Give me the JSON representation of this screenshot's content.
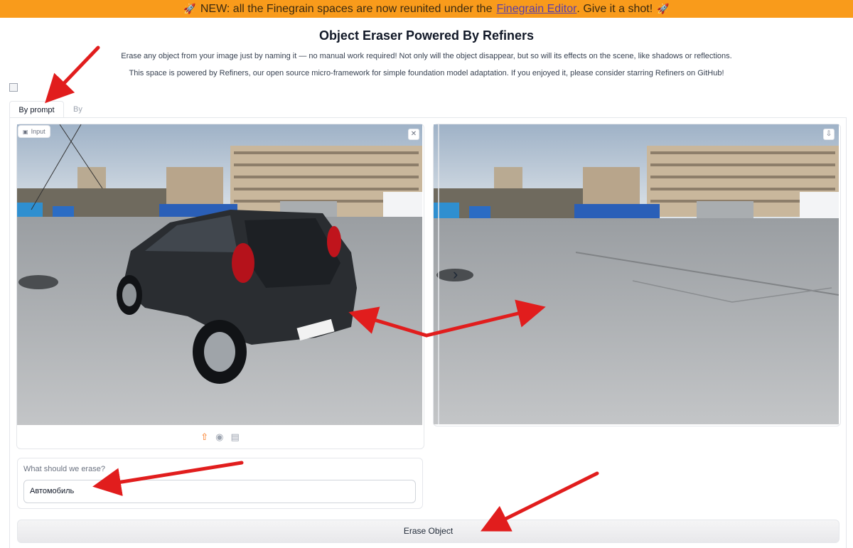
{
  "banner": {
    "prefix": "NEW: all the Finegrain spaces are now reunited under the",
    "link": "Finegrain Editor",
    "suffix": ". Give it a shot!",
    "color": "#f99b1b"
  },
  "header": {
    "title": "Object Eraser Powered By Refiners",
    "line1": "Erase any object from your image just by naming it — no manual work required! Not only will the object disappear, but so will its effects on the scene, like shadows or reflections.",
    "line2": "This space is powered by Refiners, our open source micro-framework for simple foundation model adaptation. If you enjoyed it, please consider starring Refiners on GitHub!"
  },
  "tabs": [
    {
      "label": "By prompt",
      "active": true
    },
    {
      "label": "By bounding box",
      "active": false
    }
  ],
  "input_image": {
    "badge": "Input",
    "clear_icon": "close-icon",
    "source_icons": [
      "upload-icon",
      "webcam-icon",
      "clipboard-icon"
    ]
  },
  "output_image": {
    "download_icon": "download-icon",
    "slider_icon": "chevron-right-icon"
  },
  "prompt": {
    "label": "What should we erase?",
    "value": "Автомобиль"
  },
  "erase_button": {
    "label": "Erase Object"
  },
  "annotation_color": "#e11d1d"
}
